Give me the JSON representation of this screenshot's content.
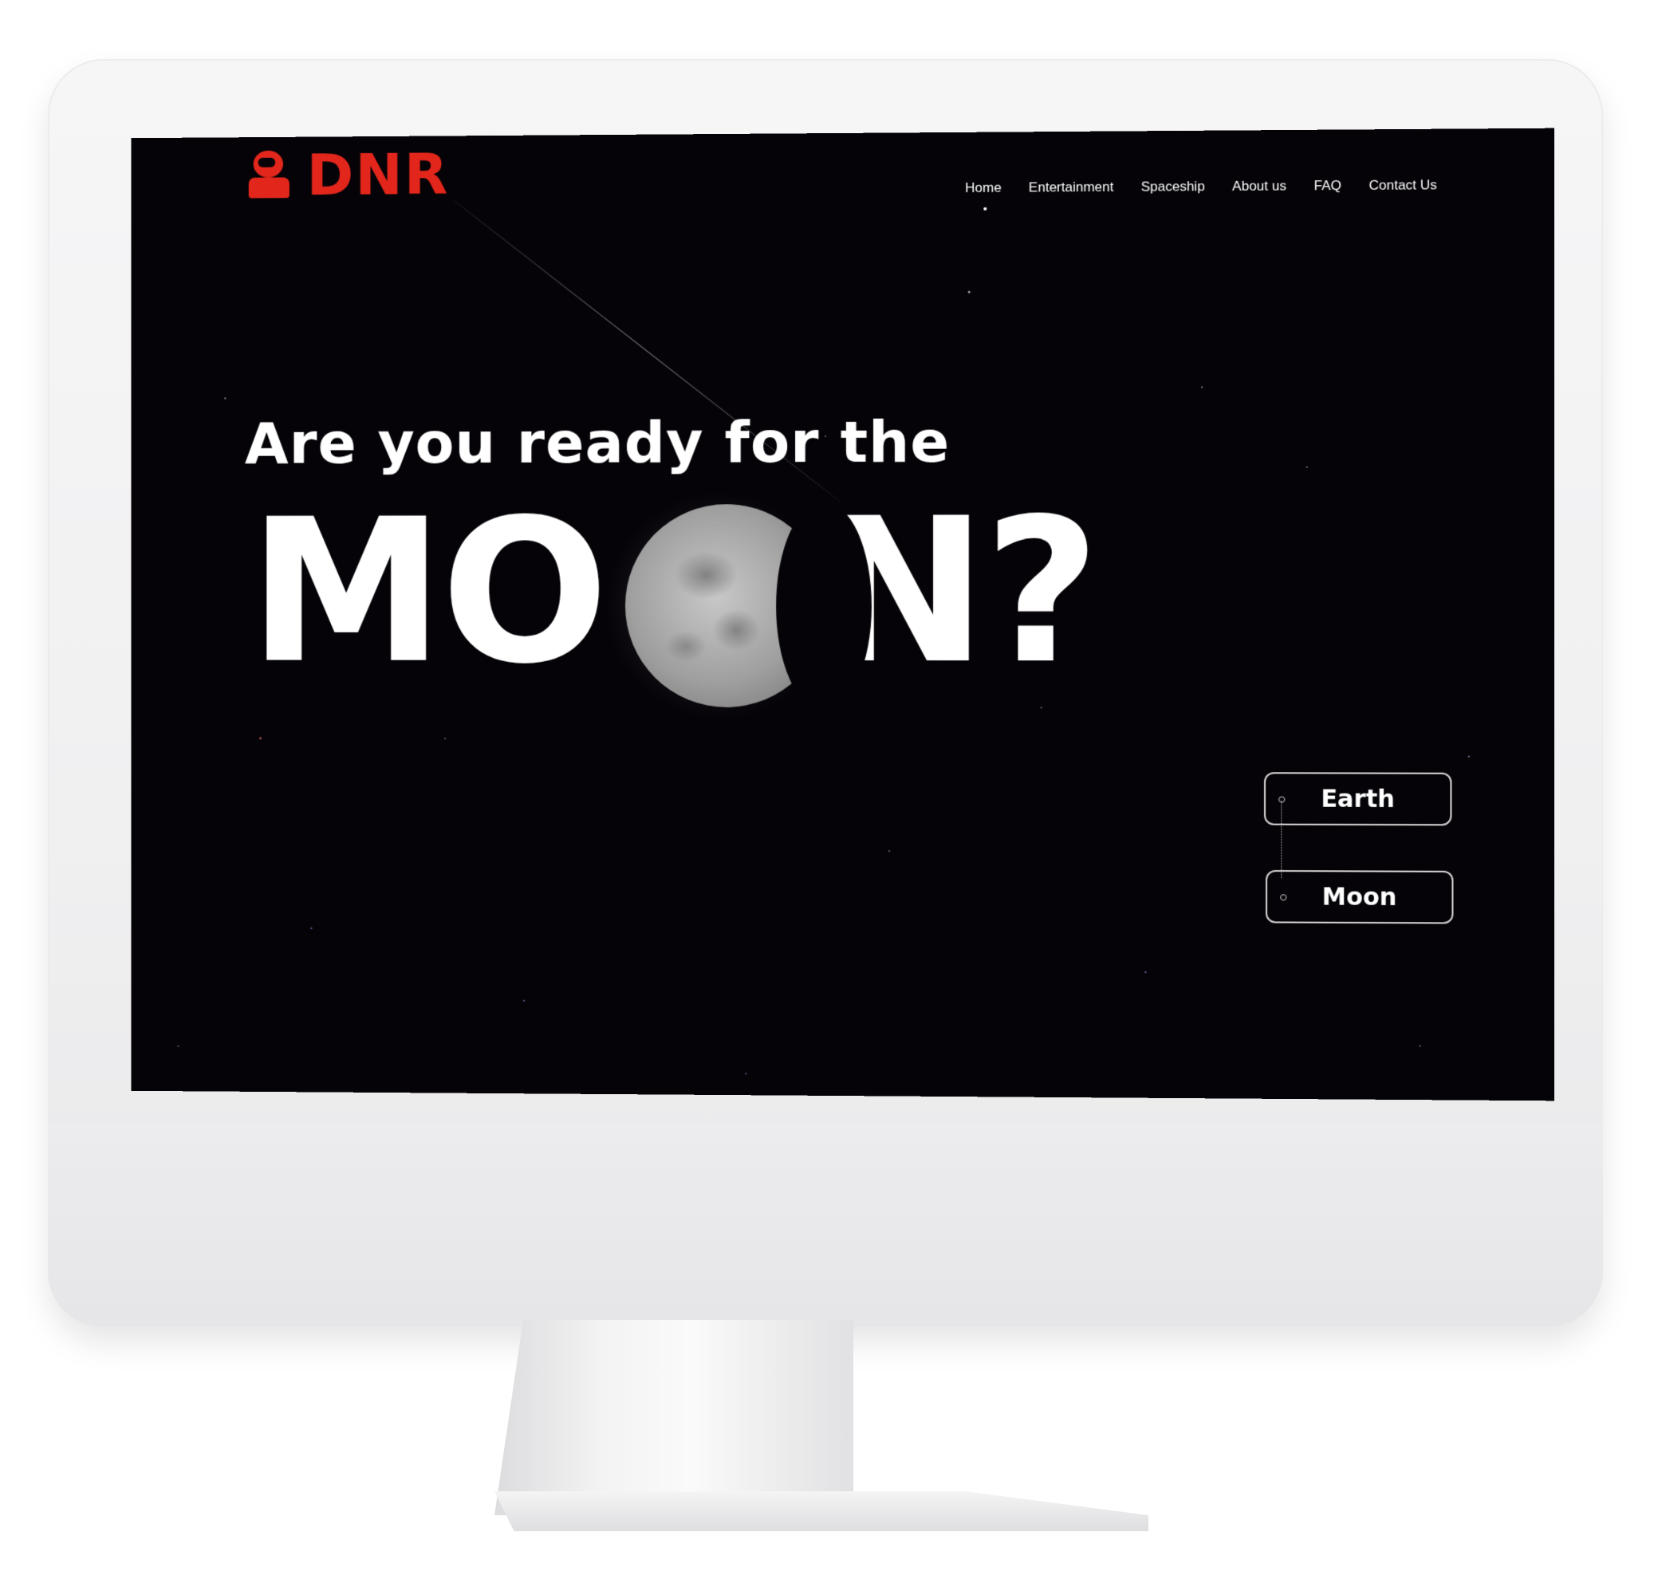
{
  "brand": {
    "name": "DNR",
    "color": "#e3261b",
    "logo_icon": "astronaut-icon"
  },
  "nav": {
    "items": [
      "Home",
      "Entertainment",
      "Spaceship",
      "About us",
      "FAQ",
      "Contact Us"
    ],
    "active": "Home"
  },
  "hero": {
    "line1": "Are you ready for the",
    "line2_start": "MO",
    "line2_end": "N?"
  },
  "destinations": {
    "earth_label": "Earth",
    "moon_label": "Moon"
  },
  "colors": {
    "background": "#050307",
    "text": "#ffffff",
    "accent": "#e3261b"
  }
}
